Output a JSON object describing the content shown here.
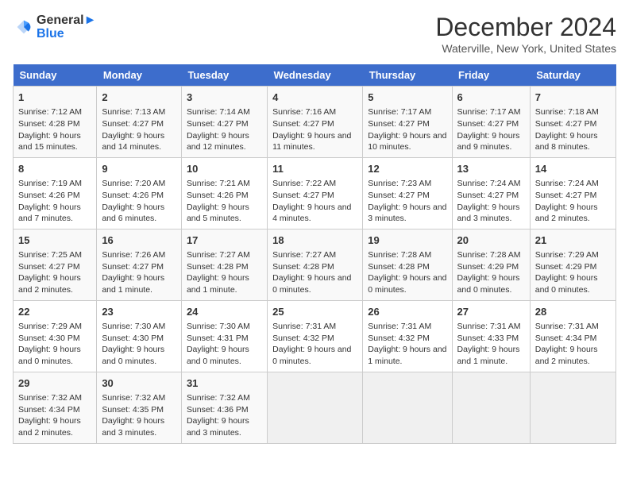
{
  "header": {
    "logo_line1": "General",
    "logo_line2": "Blue",
    "month_title": "December 2024",
    "location": "Waterville, New York, United States"
  },
  "days_of_week": [
    "Sunday",
    "Monday",
    "Tuesday",
    "Wednesday",
    "Thursday",
    "Friday",
    "Saturday"
  ],
  "weeks": [
    [
      {
        "day": "1",
        "sunrise": "7:12 AM",
        "sunset": "4:28 PM",
        "daylight": "9 hours and 15 minutes."
      },
      {
        "day": "2",
        "sunrise": "7:13 AM",
        "sunset": "4:27 PM",
        "daylight": "9 hours and 14 minutes."
      },
      {
        "day": "3",
        "sunrise": "7:14 AM",
        "sunset": "4:27 PM",
        "daylight": "9 hours and 12 minutes."
      },
      {
        "day": "4",
        "sunrise": "7:16 AM",
        "sunset": "4:27 PM",
        "daylight": "9 hours and 11 minutes."
      },
      {
        "day": "5",
        "sunrise": "7:17 AM",
        "sunset": "4:27 PM",
        "daylight": "9 hours and 10 minutes."
      },
      {
        "day": "6",
        "sunrise": "7:17 AM",
        "sunset": "4:27 PM",
        "daylight": "9 hours and 9 minutes."
      },
      {
        "day": "7",
        "sunrise": "7:18 AM",
        "sunset": "4:27 PM",
        "daylight": "9 hours and 8 minutes."
      }
    ],
    [
      {
        "day": "8",
        "sunrise": "7:19 AM",
        "sunset": "4:26 PM",
        "daylight": "9 hours and 7 minutes."
      },
      {
        "day": "9",
        "sunrise": "7:20 AM",
        "sunset": "4:26 PM",
        "daylight": "9 hours and 6 minutes."
      },
      {
        "day": "10",
        "sunrise": "7:21 AM",
        "sunset": "4:26 PM",
        "daylight": "9 hours and 5 minutes."
      },
      {
        "day": "11",
        "sunrise": "7:22 AM",
        "sunset": "4:27 PM",
        "daylight": "9 hours and 4 minutes."
      },
      {
        "day": "12",
        "sunrise": "7:23 AM",
        "sunset": "4:27 PM",
        "daylight": "9 hours and 3 minutes."
      },
      {
        "day": "13",
        "sunrise": "7:24 AM",
        "sunset": "4:27 PM",
        "daylight": "9 hours and 3 minutes."
      },
      {
        "day": "14",
        "sunrise": "7:24 AM",
        "sunset": "4:27 PM",
        "daylight": "9 hours and 2 minutes."
      }
    ],
    [
      {
        "day": "15",
        "sunrise": "7:25 AM",
        "sunset": "4:27 PM",
        "daylight": "9 hours and 2 minutes."
      },
      {
        "day": "16",
        "sunrise": "7:26 AM",
        "sunset": "4:27 PM",
        "daylight": "9 hours and 1 minute."
      },
      {
        "day": "17",
        "sunrise": "7:27 AM",
        "sunset": "4:28 PM",
        "daylight": "9 hours and 1 minute."
      },
      {
        "day": "18",
        "sunrise": "7:27 AM",
        "sunset": "4:28 PM",
        "daylight": "9 hours and 0 minutes."
      },
      {
        "day": "19",
        "sunrise": "7:28 AM",
        "sunset": "4:28 PM",
        "daylight": "9 hours and 0 minutes."
      },
      {
        "day": "20",
        "sunrise": "7:28 AM",
        "sunset": "4:29 PM",
        "daylight": "9 hours and 0 minutes."
      },
      {
        "day": "21",
        "sunrise": "7:29 AM",
        "sunset": "4:29 PM",
        "daylight": "9 hours and 0 minutes."
      }
    ],
    [
      {
        "day": "22",
        "sunrise": "7:29 AM",
        "sunset": "4:30 PM",
        "daylight": "9 hours and 0 minutes."
      },
      {
        "day": "23",
        "sunrise": "7:30 AM",
        "sunset": "4:30 PM",
        "daylight": "9 hours and 0 minutes."
      },
      {
        "day": "24",
        "sunrise": "7:30 AM",
        "sunset": "4:31 PM",
        "daylight": "9 hours and 0 minutes."
      },
      {
        "day": "25",
        "sunrise": "7:31 AM",
        "sunset": "4:32 PM",
        "daylight": "9 hours and 0 minutes."
      },
      {
        "day": "26",
        "sunrise": "7:31 AM",
        "sunset": "4:32 PM",
        "daylight": "9 hours and 1 minute."
      },
      {
        "day": "27",
        "sunrise": "7:31 AM",
        "sunset": "4:33 PM",
        "daylight": "9 hours and 1 minute."
      },
      {
        "day": "28",
        "sunrise": "7:31 AM",
        "sunset": "4:34 PM",
        "daylight": "9 hours and 2 minutes."
      }
    ],
    [
      {
        "day": "29",
        "sunrise": "7:32 AM",
        "sunset": "4:34 PM",
        "daylight": "9 hours and 2 minutes."
      },
      {
        "day": "30",
        "sunrise": "7:32 AM",
        "sunset": "4:35 PM",
        "daylight": "9 hours and 3 minutes."
      },
      {
        "day": "31",
        "sunrise": "7:32 AM",
        "sunset": "4:36 PM",
        "daylight": "9 hours and 3 minutes."
      },
      null,
      null,
      null,
      null
    ]
  ]
}
